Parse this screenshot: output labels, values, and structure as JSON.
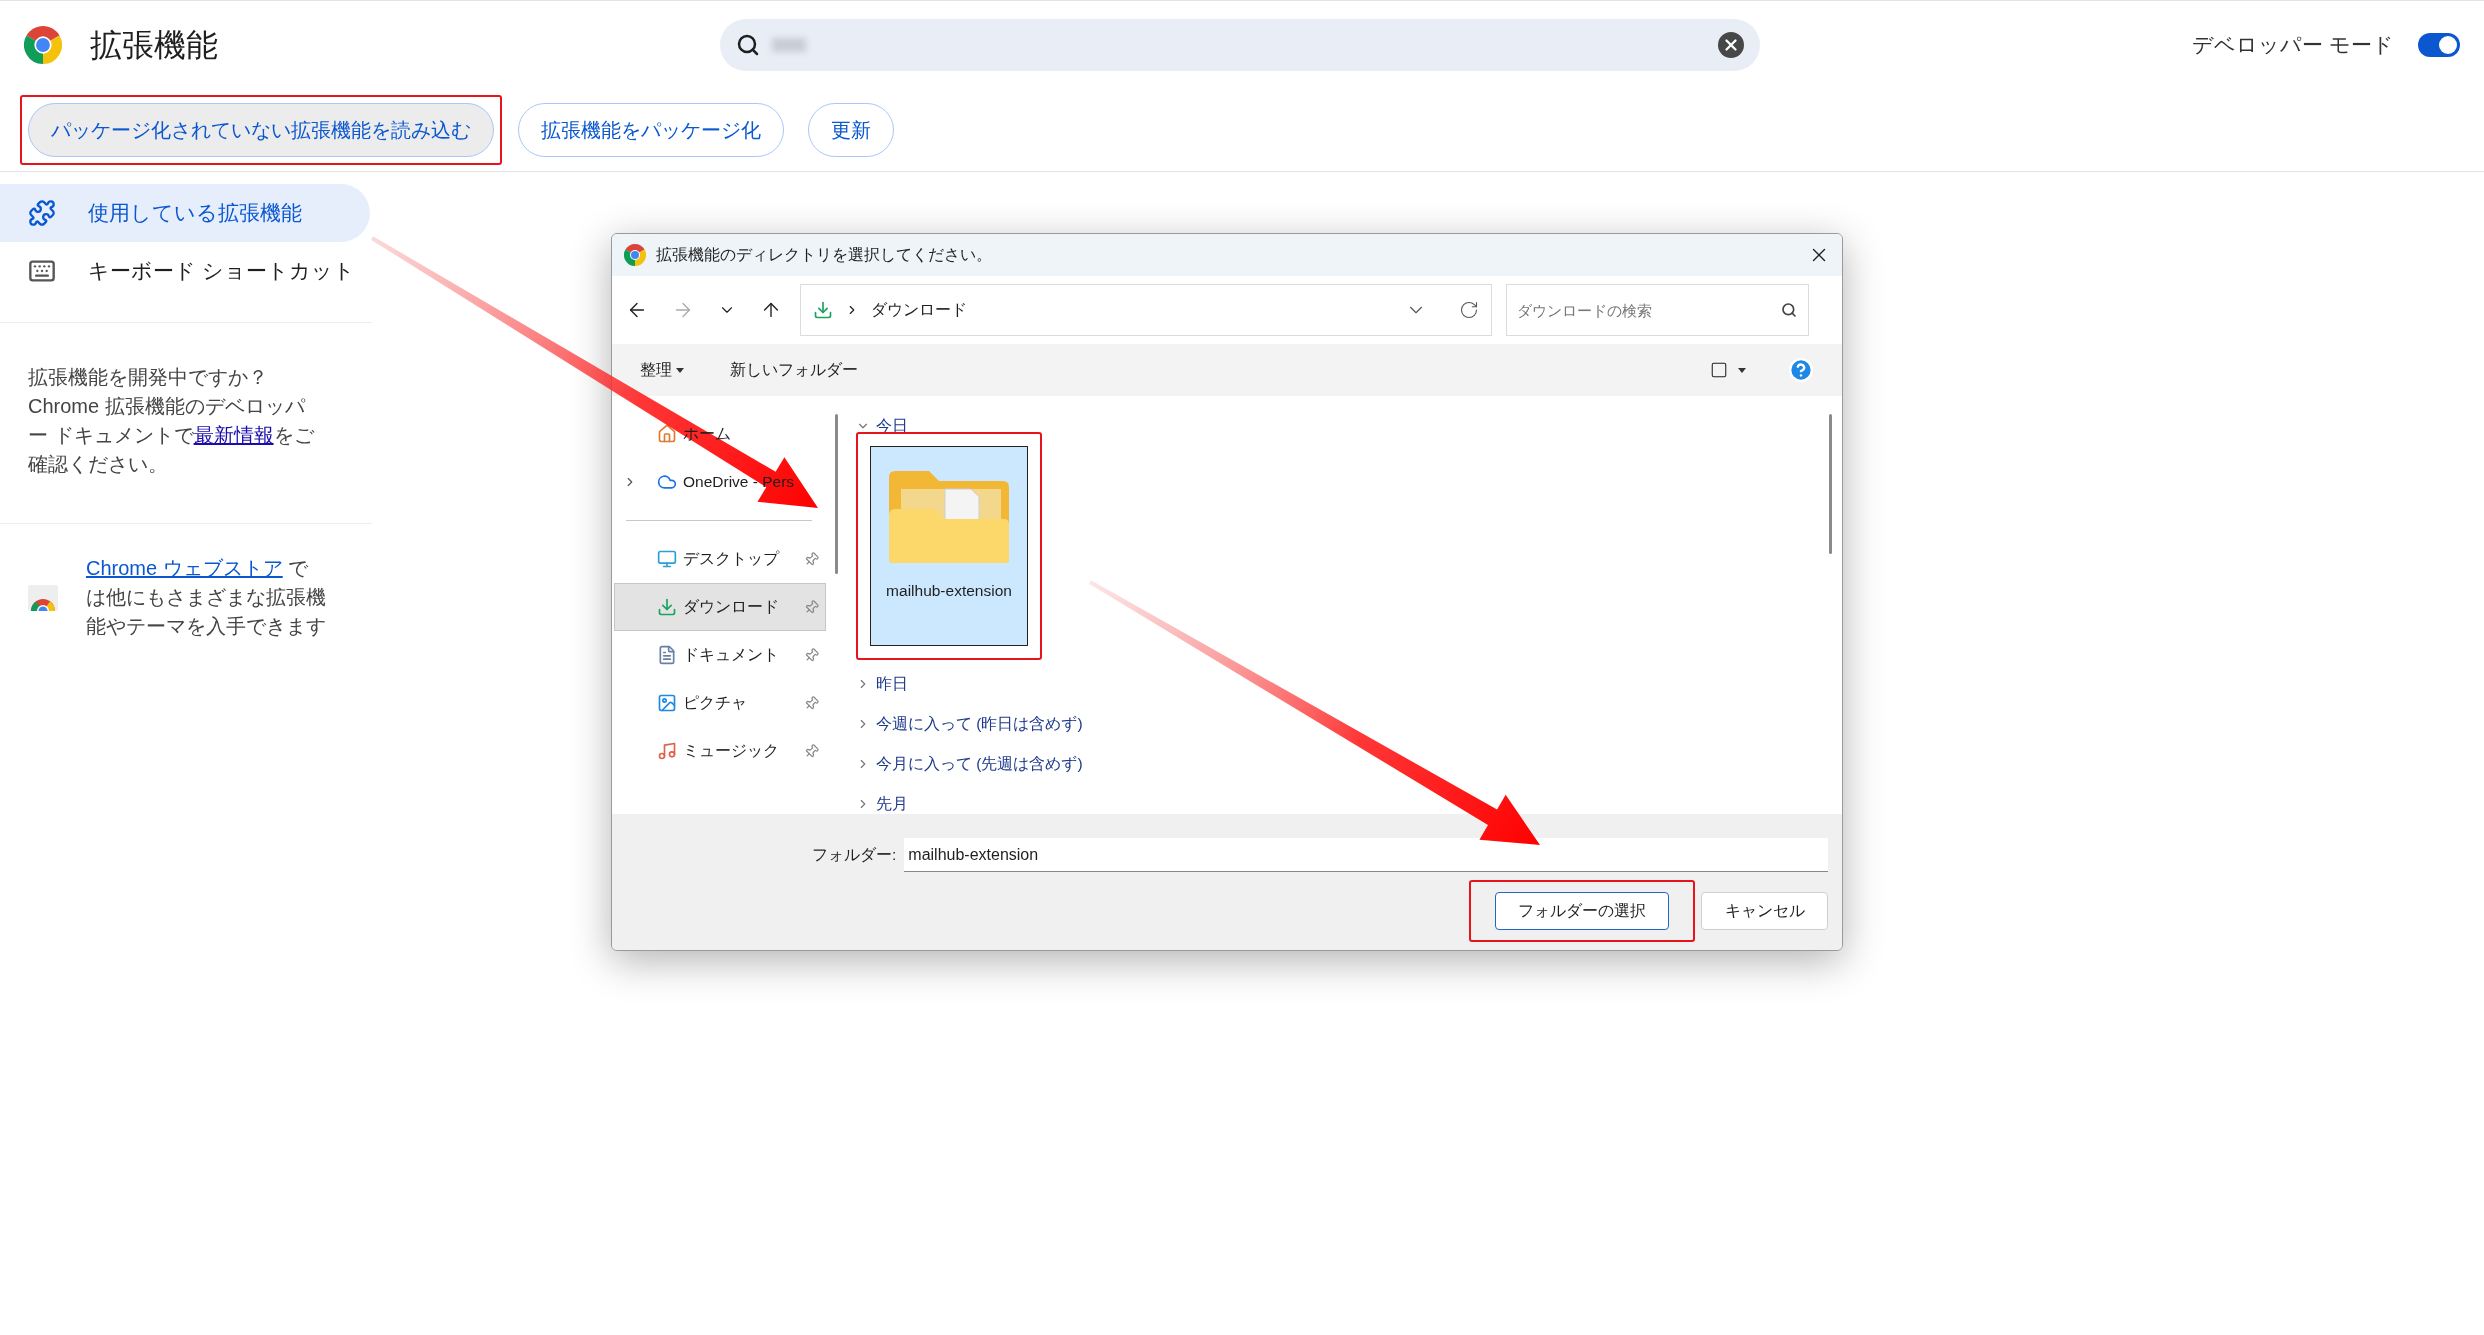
{
  "header": {
    "title": "拡張機能",
    "search": {
      "redacted": true
    },
    "developer_mode": {
      "label": "デベロッパー モード",
      "on": true
    }
  },
  "toolbar_buttons": [
    {
      "label": "パッケージ化されていない拡張機能を読み込む",
      "highlighted": true
    },
    {
      "label": "拡張機能をパッケージ化",
      "highlighted": false
    },
    {
      "label": "更新",
      "highlighted": false
    }
  ],
  "sidebar": {
    "items": [
      {
        "label": "使用している拡張機能",
        "kind": "extensions",
        "selected": true
      },
      {
        "label": "キーボード ショートカット",
        "kind": "keyboard",
        "selected": false
      }
    ],
    "dev_note": {
      "before": "拡張機能を開発中ですか？Chrome 拡張機能のデベロッパー ドキュメントで",
      "link": "最新情報",
      "after": "をご確認ください。"
    },
    "webstore_note": {
      "link": "Chrome ウェブストア",
      "after": " では他にもさまざまな拡張機能やテーマを入手できます"
    }
  },
  "dialog": {
    "title": "拡張機能のディレクトリを選択してください。",
    "path": "ダウンロード",
    "search_placeholder": "ダウンロードの検索",
    "commands": [
      {
        "label": "整理",
        "menu": true
      },
      {
        "label": "新しいフォルダー",
        "menu": false
      }
    ],
    "nav_items": [
      {
        "label": "ホーム",
        "kind": "home",
        "pinned": false,
        "selected": false,
        "expandable": false
      },
      {
        "label": "OneDrive - Pers",
        "kind": "cloud",
        "pinned": false,
        "selected": false,
        "expandable": true
      },
      {
        "kind": "divider"
      },
      {
        "label": "デスクトップ",
        "kind": "desktop",
        "pinned": true,
        "selected": false,
        "expandable": false
      },
      {
        "label": "ダウンロード",
        "kind": "download",
        "pinned": true,
        "selected": true,
        "expandable": false
      },
      {
        "label": "ドキュメント",
        "kind": "document",
        "pinned": true,
        "selected": false,
        "expandable": false
      },
      {
        "label": "ピクチャ",
        "kind": "picture",
        "pinned": true,
        "selected": false,
        "expandable": false
      },
      {
        "label": "ミュージック",
        "kind": "music",
        "pinned": true,
        "selected": false,
        "expandable": false
      }
    ],
    "groups": [
      {
        "label": "今日",
        "expanded": true,
        "files": [
          {
            "name": "mailhub-extension",
            "selected": true,
            "highlighted": true
          }
        ]
      },
      {
        "label": "昨日",
        "expanded": false
      },
      {
        "label": "今週に入って (昨日は含めず)",
        "expanded": false
      },
      {
        "label": "今月に入って (先週は含めず)",
        "expanded": false
      },
      {
        "label": "先月",
        "expanded": false
      }
    ],
    "folder_label": "フォルダー:",
    "folder_value": "mailhub-extension",
    "buttons": [
      {
        "label": "フォルダーの選択",
        "primary": true,
        "highlighted": true
      },
      {
        "label": "キャンセル",
        "primary": false,
        "highlighted": false
      }
    ]
  }
}
